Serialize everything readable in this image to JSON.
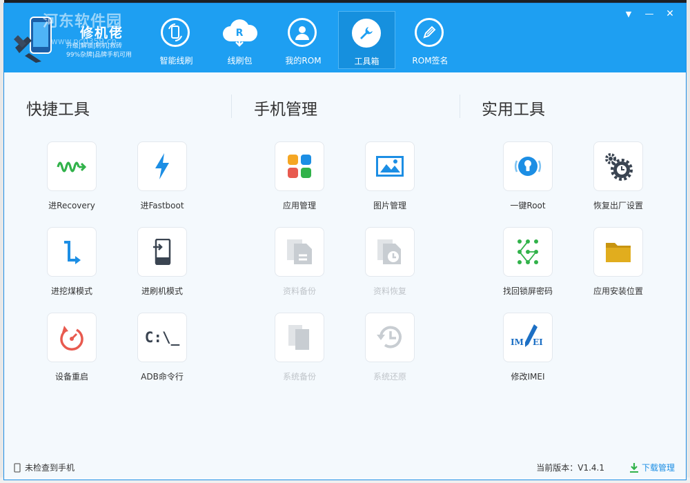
{
  "app": {
    "title": "修机佬",
    "subtitle_line1": "升级|解锁|刷机|救砖",
    "subtitle_line2": "99%杂牌|品牌手机可用",
    "watermark": "河东软件园",
    "watermark_url": "www.pc0359.cn"
  },
  "nav": {
    "items": [
      {
        "label": "智能线刷",
        "icon": "phone-refresh-icon"
      },
      {
        "label": "线刷包",
        "icon": "cloud-download-icon"
      },
      {
        "label": "我的ROM",
        "icon": "user-icon"
      },
      {
        "label": "工具箱",
        "icon": "wrench-icon",
        "active": true
      },
      {
        "label": "ROM签名",
        "icon": "pen-icon"
      }
    ]
  },
  "window_controls": {
    "dropdown": "▼",
    "minimize": "—",
    "close": "✕"
  },
  "sections": {
    "quick": {
      "title": "快捷工具",
      "tools": [
        {
          "label": "进Recovery",
          "icon": "wave-arrow-icon"
        },
        {
          "label": "进Fastboot",
          "icon": "lightning-icon"
        },
        {
          "label": "进挖煤模式",
          "icon": "curved-arrow-icon"
        },
        {
          "label": "进刷机模式",
          "icon": "phone-enter-icon"
        },
        {
          "label": "设备重启",
          "icon": "restart-icon"
        },
        {
          "label": "ADB命令行",
          "icon": "terminal-icon",
          "glyph": "C:\\_"
        }
      ]
    },
    "phone": {
      "title": "手机管理",
      "tools": [
        {
          "label": "应用管理",
          "icon": "app-grid-icon",
          "disabled": false
        },
        {
          "label": "图片管理",
          "icon": "picture-icon",
          "disabled": false
        },
        {
          "label": "资料备份",
          "icon": "file-backup-icon",
          "disabled": true
        },
        {
          "label": "资料恢复",
          "icon": "file-restore-icon",
          "disabled": true
        },
        {
          "label": "系统备份",
          "icon": "system-backup-icon",
          "disabled": true
        },
        {
          "label": "系统还原",
          "icon": "history-icon",
          "disabled": true
        }
      ]
    },
    "utility": {
      "title": "实用工具",
      "tools": [
        {
          "label": "一键Root",
          "icon": "keyhole-icon"
        },
        {
          "label": "恢复出厂设置",
          "icon": "gears-icon"
        },
        {
          "label": "找回锁屏密码",
          "icon": "pattern-lock-icon"
        },
        {
          "label": "应用安装位置",
          "icon": "folder-icon"
        },
        {
          "label": "修改IMEI",
          "icon": "imei-pen-icon",
          "glyph_left": "IM",
          "glyph_right": "EI"
        }
      ]
    }
  },
  "status": {
    "device": "未检查到手机",
    "version": "当前版本：V1.4.1",
    "download": "下载管理"
  },
  "colors": {
    "header": "#1e9ff2",
    "accent_green": "#31b24a",
    "accent_blue": "#1c8ee4",
    "accent_red": "#e85a4f",
    "accent_gold": "#e1ad1e"
  }
}
